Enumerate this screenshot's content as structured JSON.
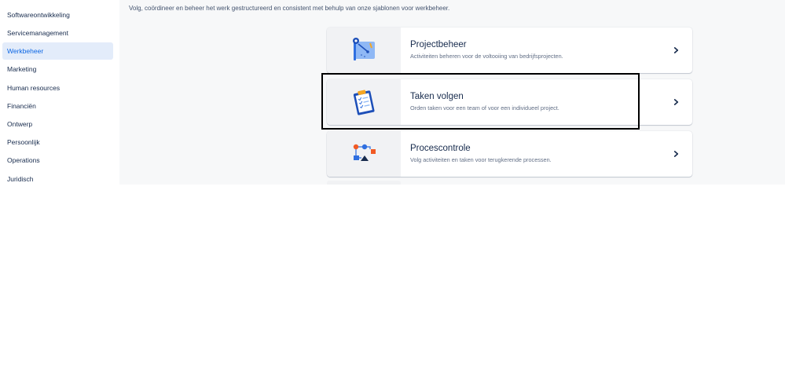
{
  "sidebar": {
    "items": [
      {
        "label": "Softwareontwikkeling",
        "active": false
      },
      {
        "label": "Servicemanagement",
        "active": false
      },
      {
        "label": "Werkbeheer",
        "active": true
      },
      {
        "label": "Marketing",
        "active": false
      },
      {
        "label": "Human resources",
        "active": false
      },
      {
        "label": "Financiën",
        "active": false
      },
      {
        "label": "Ontwerp",
        "active": false
      },
      {
        "label": "Persoonlijk",
        "active": false
      },
      {
        "label": "Operations",
        "active": false
      },
      {
        "label": "Juridisch",
        "active": false
      }
    ]
  },
  "main": {
    "intro": "Volg, coördineer en beheer het werk gestructureerd en consistent met behulp van onze sjablonen voor werkbeheer.",
    "templates": [
      {
        "title": "Projectbeheer",
        "description": "Activiteiten beheren voor de voltooiing van bedrijfsprojecten.",
        "icon": "project-board-icon"
      },
      {
        "title": "Taken volgen",
        "description": "Orden taken voor een team of voor een individueel project.",
        "icon": "clipboard-checklist-icon",
        "highlighted": true
      },
      {
        "title": "Procescontrole",
        "description": "Volg activiteiten en taken voor terugkerende processen.",
        "icon": "process-flow-icon"
      }
    ]
  },
  "colors": {
    "accent": "#0c66e4",
    "active_bg": "#e3ecfa",
    "main_bg": "#f7f8f9",
    "highlight_border": "#000000"
  }
}
